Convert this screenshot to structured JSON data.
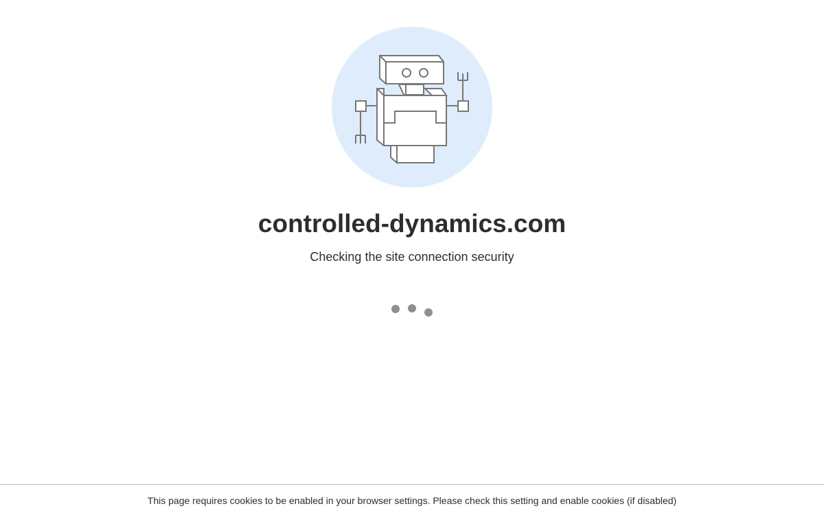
{
  "site": {
    "domain": "controlled-dynamics.com",
    "status": "Checking the site connection security"
  },
  "illustration": {
    "icon": "robot-icon",
    "background_color": "#dfecfb",
    "stroke_color": "#777777"
  },
  "loader": {
    "icon": "loading-dots",
    "dot_color": "#8f8f8f"
  },
  "footer": {
    "notice": "This page requires cookies to be enabled in your browser settings. Please check this setting and enable cookies (if disabled)"
  }
}
